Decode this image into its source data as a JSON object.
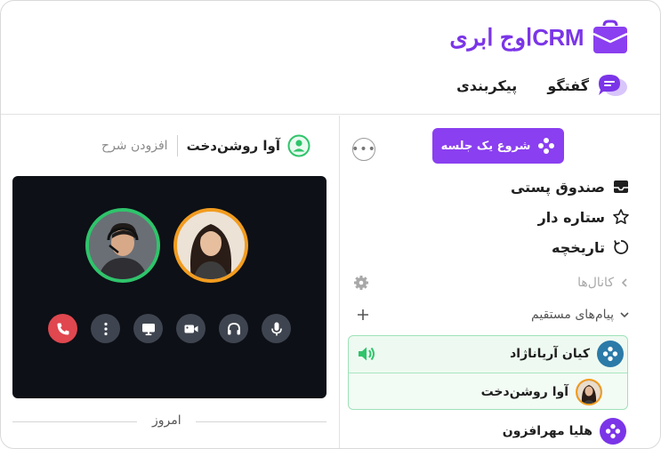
{
  "header": {
    "logo_text": "CRMاوج ابری",
    "nav": [
      {
        "label": "گفتگو",
        "icon": "chat-bubble-icon"
      },
      {
        "label": "پیکربندی"
      }
    ]
  },
  "sidebar": {
    "start_button": "شروع یک جلسه",
    "more_icon": "more-horizontal-icon",
    "menu": [
      {
        "label": "صندوق پستی",
        "icon": "inbox-icon"
      },
      {
        "label": "ستاره دار",
        "icon": "star-icon"
      },
      {
        "label": "تاریخچه",
        "icon": "history-icon"
      }
    ],
    "channels_label": "کانال‌ها",
    "direct_messages_label": "پیام‌های مستقیم",
    "members": [
      {
        "name": "کیان آریاناژاد",
        "speaking": true
      },
      {
        "name": "آوا روشن‌دخت"
      },
      {
        "name": "هلیا مهرافزون"
      }
    ]
  },
  "call": {
    "participant_name": "آوا روشن‌دخت",
    "add_description": "افزودن شرح",
    "controls": [
      "end-call-icon",
      "more-vertical-icon",
      "screen-share-icon",
      "video-camera-icon",
      "headphones-icon",
      "microphone-icon"
    ],
    "date_divider": "امروز"
  },
  "colors": {
    "accent": "#8a3ff0",
    "green": "#2fc46b",
    "orange": "#f29c1f",
    "video_bg": "#0d1016"
  }
}
